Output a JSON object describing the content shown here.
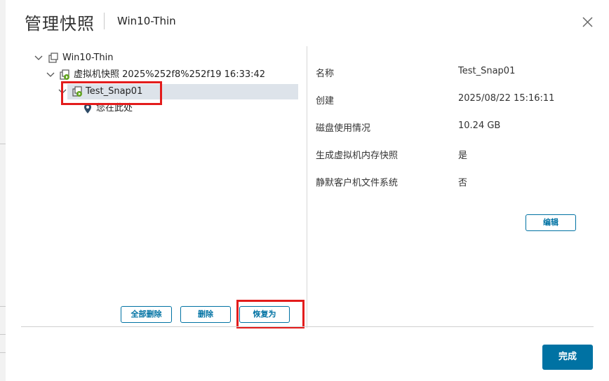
{
  "dialog": {
    "title": "管理快照",
    "subtitle": "Win10-Thin",
    "close_icon": "close-icon"
  },
  "tree": {
    "root": {
      "label": "Win10-Thin",
      "icon": "vm-icon",
      "expanded": true
    },
    "snapshot_parent": {
      "label": "虚拟机快照 2025%252f8%252f19 16:33:42",
      "icon": "snapshot-icon",
      "expanded": true
    },
    "snapshot_selected": {
      "label": "Test_Snap01",
      "icon": "snapshot-running-icon",
      "expanded": true,
      "selected": true
    },
    "here": {
      "label": "您在此处",
      "icon": "location-pin-icon"
    }
  },
  "details": {
    "rows": [
      {
        "label": "名称",
        "value": "Test_Snap01"
      },
      {
        "label": "创建",
        "value": "2025/08/22 15:16:11"
      },
      {
        "label": "磁盘使用情况",
        "value": "10.24 GB"
      },
      {
        "label": "生成虚拟机内存快照",
        "value": "是"
      },
      {
        "label": "静默客户机文件系统",
        "value": "否"
      }
    ],
    "edit_label": "编辑"
  },
  "actions": {
    "delete_all_label": "全部删除",
    "delete_label": "删除",
    "revert_label": "恢复为",
    "done_label": "完成"
  },
  "colors": {
    "accent": "#0072a3",
    "highlight": "#e31c1c",
    "selection": "#dde3ea"
  }
}
